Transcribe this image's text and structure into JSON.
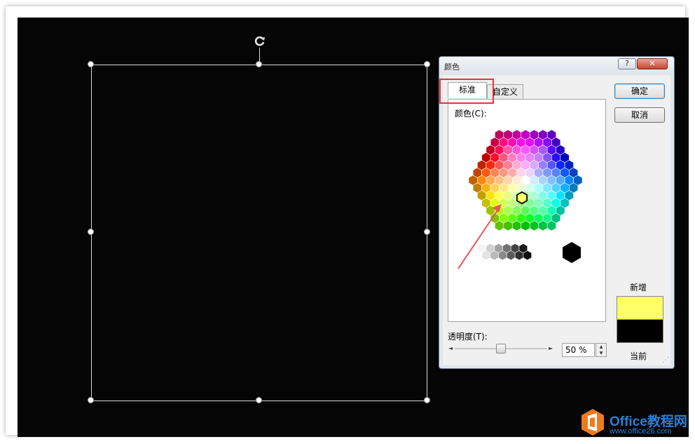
{
  "dialog": {
    "title": "颜色",
    "help_label": "?",
    "close_label": "✕",
    "tabs": [
      {
        "label": "标准",
        "selected": true
      },
      {
        "label": "自定义",
        "selected": false
      }
    ],
    "colors_label": "颜色(C):",
    "ok_label": "确定",
    "cancel_label": "取消",
    "new_label": "新增",
    "current_label": "当前",
    "new_color": "#ffff66",
    "current_color": "#000000",
    "transparency_label": "透明度(T):",
    "transparency_value": "50 %",
    "transparency_fraction": 0.5
  },
  "annotation": {
    "highlight_color": "#e8323c"
  },
  "watermark": {
    "brand": "Office教程网",
    "url": "www.office26.com"
  }
}
